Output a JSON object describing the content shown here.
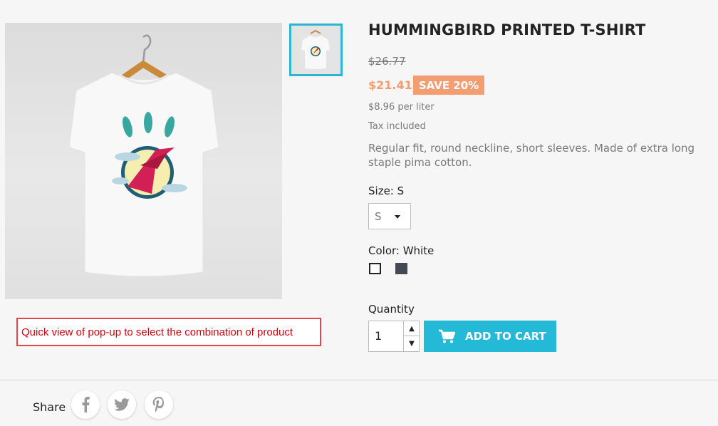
{
  "product": {
    "title": "HUMMINGBIRD PRINTED T-SHIRT",
    "old_price": "$26.77",
    "price": "$21.41",
    "discount_badge": "SAVE 20%",
    "unit_price": "$8.96 per liter",
    "tax_note": "Tax included",
    "description": "Regular fit, round neckline, short sleeves. Made of extra long staple pima cotton."
  },
  "images": {
    "main_alt": "t-shirt-image",
    "thumbnail_alt": "t-shirt-thumbnail"
  },
  "variants": {
    "size_label": "Size: S",
    "size_selected": "S",
    "color_label": "Color: White",
    "colors": [
      {
        "name": "White",
        "hex": "#ffffff",
        "selected": true
      },
      {
        "name": "Dark Grey",
        "hex": "#434a54",
        "selected": false
      }
    ]
  },
  "quantity": {
    "label": "Quantity",
    "value": "1"
  },
  "cart": {
    "button_label": "ADD TO CART",
    "icon": "shopping-cart-icon"
  },
  "annotation": {
    "text": "Quick view of pop-up to select the combination of product"
  },
  "share": {
    "label": "Share",
    "networks": [
      "facebook-icon",
      "twitter-icon",
      "pinterest-icon"
    ]
  },
  "colors": {
    "accent": "#24b9d7",
    "discount": "#f39d72",
    "annotation_red": "#d8000c"
  }
}
